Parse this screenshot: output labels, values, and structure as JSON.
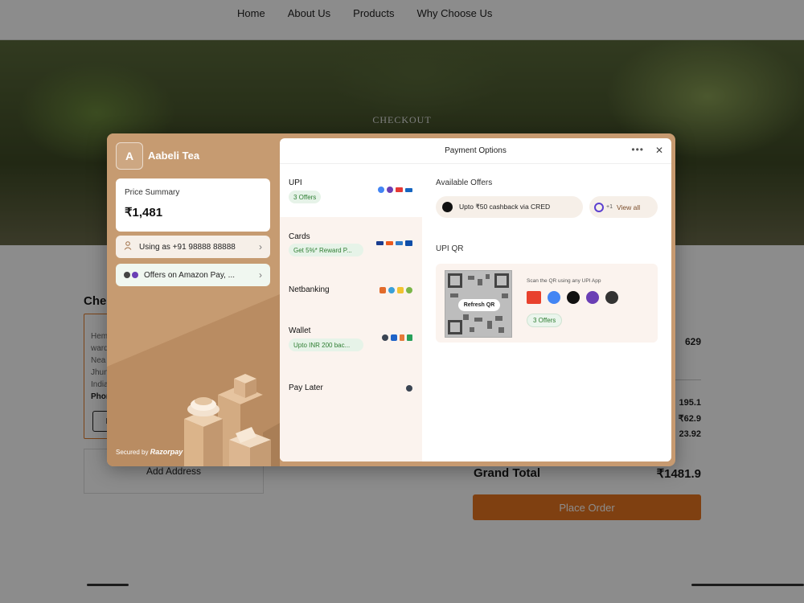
{
  "nav": {
    "links": [
      "Home",
      "About Us",
      "Products",
      "Why Choose Us"
    ]
  },
  "hero": {
    "title": "CHECKOUT"
  },
  "checkout": {
    "heading": "Checkout",
    "address_lines": [
      "Hem",
      "ward",
      "Nea",
      "Jhun",
      "India"
    ],
    "phone_label": "Phon",
    "edit_label": "E",
    "add_address": "Add Address"
  },
  "summary": {
    "values": [
      "629",
      "195.1",
      "₹62.9",
      "23.92"
    ],
    "grand_total_label": "Grand Total",
    "grand_total_value": "₹1481.9",
    "place_order": "Place Order"
  },
  "razorpay": {
    "merchant_initial": "A",
    "merchant_name": "Aabeli Tea",
    "price_summary_label": "Price Summary",
    "price_amount": "₹1,481",
    "using_as": "Using as +91 98888 88888",
    "offers_on": "Offers on Amazon Pay, ...",
    "secured_by": "Secured by",
    "brand": "Razorpay",
    "header_title": "Payment Options",
    "methods": [
      {
        "name": "UPI",
        "badge": "3 Offers"
      },
      {
        "name": "Cards",
        "badge": "Get 5%* Reward P..."
      },
      {
        "name": "Netbanking",
        "badge": ""
      },
      {
        "name": "Wallet",
        "badge": "Upto INR 200 bac..."
      },
      {
        "name": "Pay Later",
        "badge": ""
      }
    ],
    "available_offers_label": "Available Offers",
    "cred_offer": "Upto ₹50 cashback via CRED",
    "extra_offers": "+1",
    "view_all": "View all",
    "upi_qr_label": "UPI QR",
    "refresh_qr": "Refresh QR",
    "scan_text": "Scan the QR using any UPI App",
    "qr_offers": "3 Offers",
    "upi_apps": [
      "bhim-icon",
      "gpay-icon",
      "paytm-icon",
      "phonepe-icon",
      "amazonpay-icon"
    ]
  },
  "colors": {
    "accent": "#e8751f",
    "modal_tan": "#c69b71",
    "offer_green": "#2e7d32",
    "method_bg": "#fbf3ee"
  }
}
